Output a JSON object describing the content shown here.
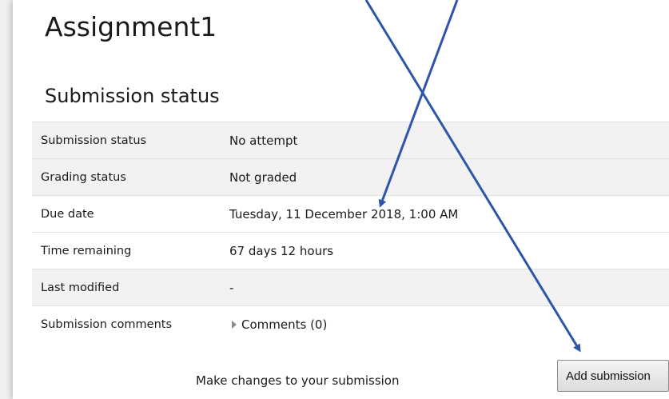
{
  "page": {
    "title": "Assignment1",
    "section_title": "Submission status"
  },
  "submission_table": {
    "rows": [
      {
        "label": "Submission status",
        "value": "No attempt"
      },
      {
        "label": "Grading status",
        "value": "Not graded"
      },
      {
        "label": "Due date",
        "value": "Tuesday, 11 December 2018, 1:00 AM"
      },
      {
        "label": "Time remaining",
        "value": "67 days 12 hours"
      },
      {
        "label": "Last modified",
        "value": "-"
      },
      {
        "label": "Submission comments",
        "value": "Comments (0)"
      }
    ]
  },
  "actions": {
    "make_changes_text": "Make changes to your submission",
    "add_submission_label": "Add submission"
  },
  "colors": {
    "arrow": "#2e55a8",
    "row_stripe": "#f2f2f2",
    "border": "#dee2e6"
  }
}
